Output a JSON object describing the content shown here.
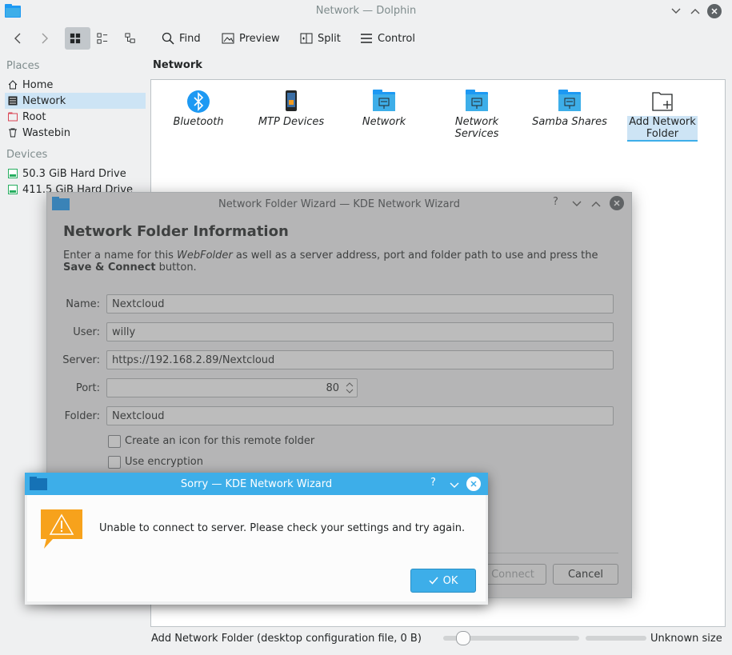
{
  "window": {
    "title": "Network — Dolphin"
  },
  "toolbar": {
    "find": "Find",
    "preview": "Preview",
    "split": "Split",
    "control": "Control"
  },
  "places": {
    "heading": "Places",
    "items": [
      {
        "label": "Home",
        "icon": "home-icon"
      },
      {
        "label": "Network",
        "icon": "network-icon"
      },
      {
        "label": "Root",
        "icon": "root-folder-icon"
      },
      {
        "label": "Wastebin",
        "icon": "trash-icon"
      }
    ]
  },
  "devices": {
    "heading": "Devices",
    "items": [
      {
        "label": "50.3 GiB Hard Drive",
        "icon": "hard-drive-icon"
      },
      {
        "label": "411.5 GiB Hard Drive",
        "icon": "hard-drive-icon"
      }
    ]
  },
  "location": {
    "label": "Network"
  },
  "files": [
    {
      "label": "Bluetooth",
      "icon": "bluetooth-icon"
    },
    {
      "label": "MTP Devices",
      "icon": "mtp-device-icon"
    },
    {
      "label": "Network",
      "icon": "network-folder-icon"
    },
    {
      "label": "Network Services",
      "icon": "network-folder-icon"
    },
    {
      "label": "Samba Shares",
      "icon": "network-folder-icon"
    },
    {
      "label": "Add Network Folder",
      "icon": "add-folder-icon"
    }
  ],
  "status": {
    "text": "Add Network Folder (desktop configuration file, 0 B)",
    "size": "Unknown size"
  },
  "wizard": {
    "title": "Network Folder Wizard — KDE Network Wizard",
    "heading": "Network Folder Information",
    "desc_1": "Enter a name for this ",
    "desc_em": "WebFolder",
    "desc_2": " as well as a server address, port and folder path to use and press the",
    "desc_bold": "Save & Connect",
    "desc_3": " button.",
    "name_label": "Name:",
    "name_value": "Nextcloud",
    "user_label": "User:",
    "user_value": "willy",
    "server_label": "Server:",
    "server_value": "https://192.168.2.89/Nextcloud",
    "port_label": "Port:",
    "port_value": "80",
    "folder_label": "Folder:",
    "folder_value": "Nextcloud",
    "create_icon_label": "Create an icon for this remote folder",
    "encryption_label": "Use encryption",
    "connect_label": "Connect",
    "cancel_label": "Cancel"
  },
  "sorry": {
    "title": "Sorry — KDE Network Wizard",
    "message": "Unable to connect to server.  Please check your settings and try again.",
    "ok_label": "OK"
  },
  "colors": {
    "accent": "#3daee9",
    "selection": "#cde4f5"
  }
}
